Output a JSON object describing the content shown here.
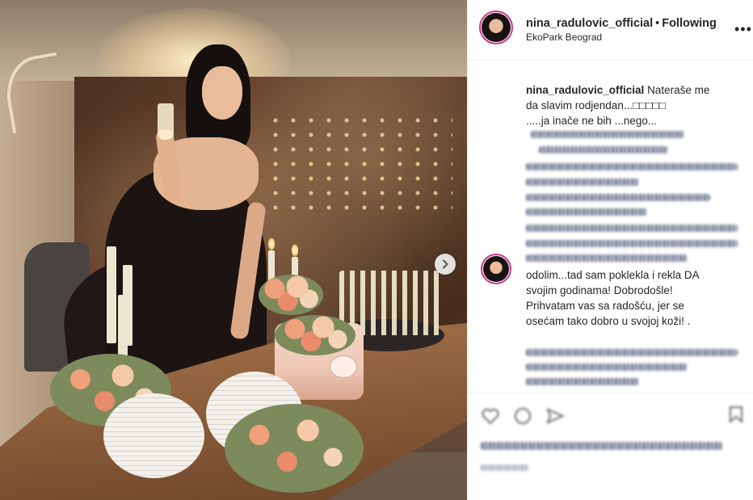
{
  "post": {
    "username": "nina_radulovic_official",
    "separator": "•",
    "follow_status": "Following",
    "location": "EkoPark Beograd",
    "more_label": "•••"
  },
  "caption": {
    "username": "nina_radulovic_official",
    "line1": "Nateraše me",
    "line2": "da slavim rodjendan...□□□□□",
    "line3": ".....ja inače ne bih ...nego..."
  },
  "comment2": {
    "line1": "odolim...tad sam poklekla i rekla DA",
    "line2": "svojim godinama! Dobrodošle!",
    "line3": "Prihvatam vas sa radošću, jer se",
    "line4": "osećam tako dobro u svojoj koži! ."
  },
  "icons": {
    "next": "chevron-right-icon",
    "like": "heart-icon",
    "comment": "comment-icon",
    "share": "share-icon",
    "save": "bookmark-icon"
  }
}
